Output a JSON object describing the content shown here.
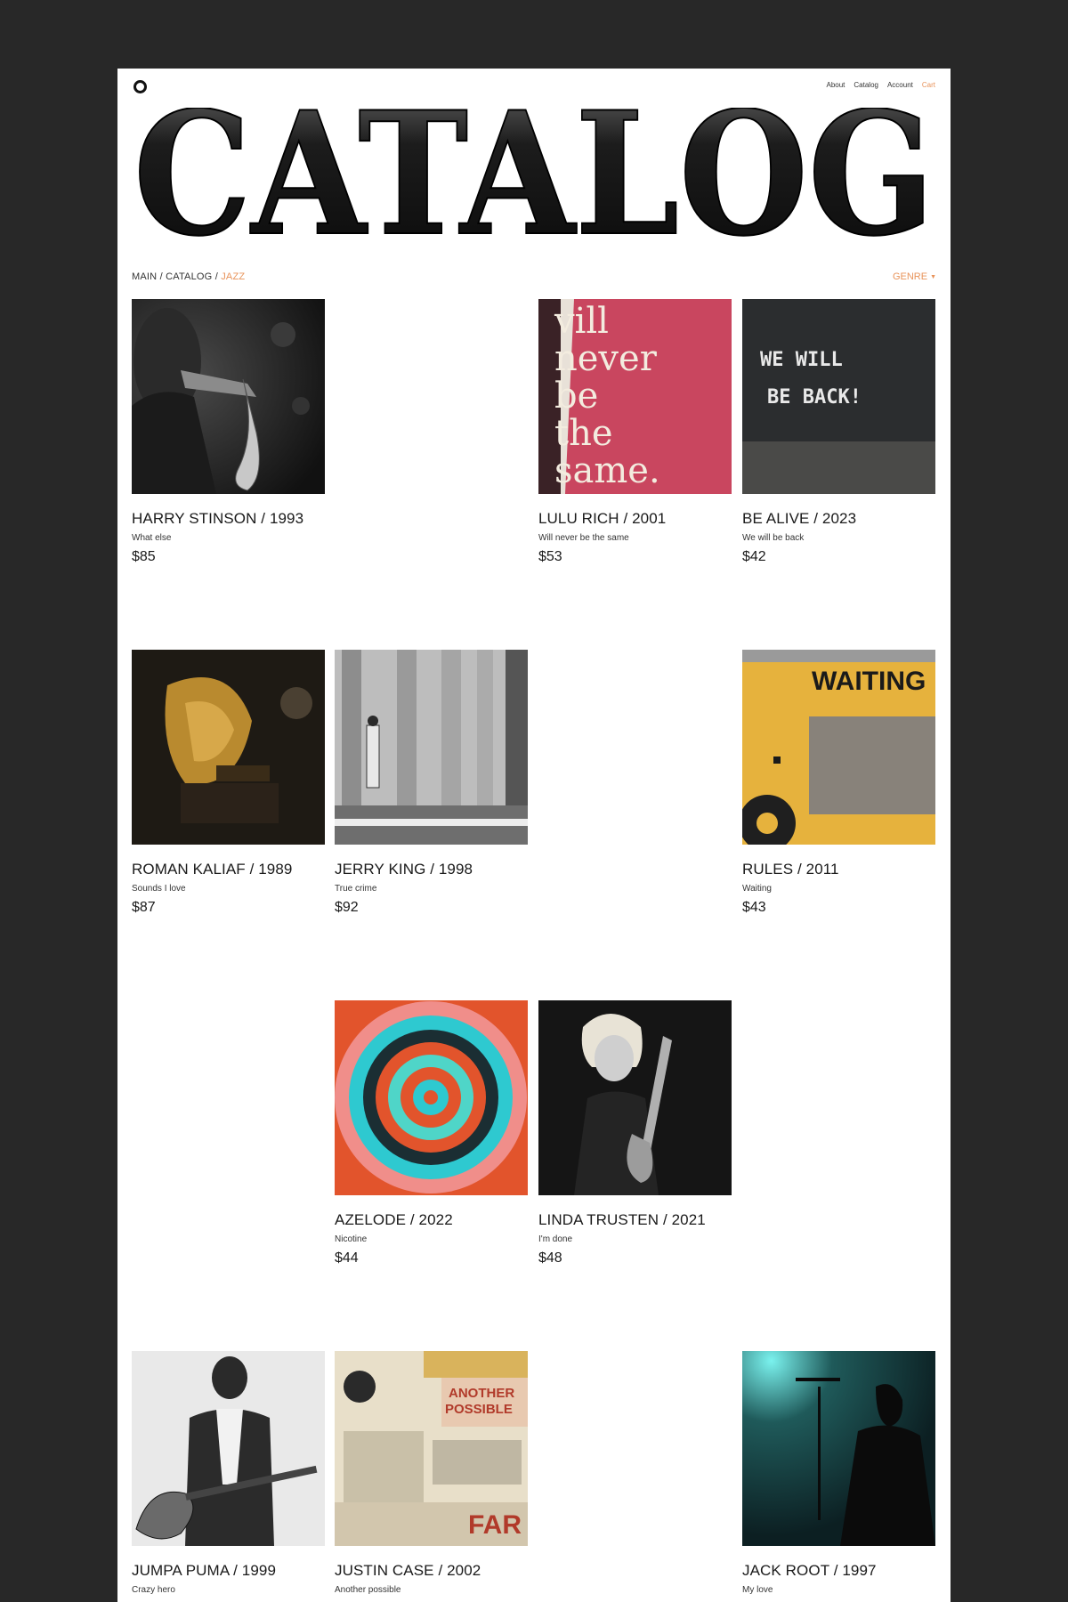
{
  "nav": {
    "about": "About",
    "catalog": "Catalog",
    "account": "Account",
    "cart": "Cart"
  },
  "hero_title": "CATALOG",
  "breadcrumb": {
    "main": "MAIN",
    "sep1": " / ",
    "catalog": "CATALOG",
    "sep2": " / ",
    "current": "JAZZ"
  },
  "filter": {
    "label": "GENRE",
    "caret": "▼"
  },
  "colors": {
    "accent": "#e8935a",
    "frame": "#282828",
    "page": "#ffffff"
  },
  "products": [
    {
      "title": "HARRY STINSON / 1993",
      "subtitle": "What else",
      "price": "$85"
    },
    {
      "title": "LULU RICH / 2001",
      "subtitle": "Will never be the same",
      "price": "$53",
      "cover_text": [
        "vill",
        "never",
        "be",
        "the",
        "same."
      ]
    },
    {
      "title": "BE ALIVE / 2023",
      "subtitle": "We will be back",
      "price": "$42",
      "cover_text": [
        "WE WILL",
        "BE BACK!"
      ]
    },
    {
      "title": "ROMAN KALIAF / 1989",
      "subtitle": "Sounds I love",
      "price": "$87"
    },
    {
      "title": "JERRY KING / 1998",
      "subtitle": "True crime",
      "price": "$92"
    },
    {
      "title": "RULES / 2011",
      "subtitle": "Waiting",
      "price": "$43",
      "cover_text": [
        "WAITING"
      ]
    },
    {
      "title": "AZELODE / 2022",
      "subtitle": "Nicotine",
      "price": "$44"
    },
    {
      "title": "LINDA TRUSTEN / 2021",
      "subtitle": "I'm done",
      "price": "$48"
    },
    {
      "title": "JUMPA PUMA / 1999",
      "subtitle": "Crazy hero",
      "price": ""
    },
    {
      "title": "JUSTIN CASE / 2002",
      "subtitle": "Another possible",
      "price": "",
      "cover_text": [
        "ANOTHER",
        "POSSIBLE",
        "FAR"
      ]
    },
    {
      "title": "JACK ROOT / 1997",
      "subtitle": "My love",
      "price": ""
    }
  ]
}
